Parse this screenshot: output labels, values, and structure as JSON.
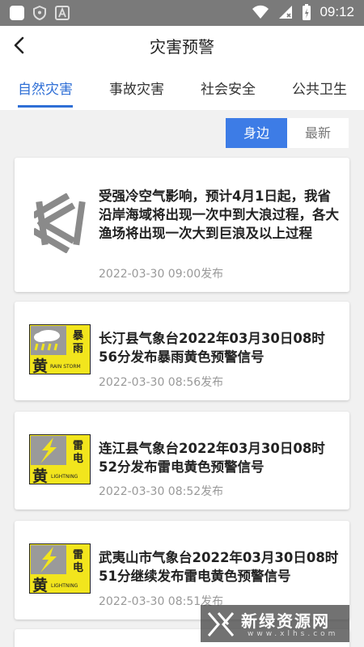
{
  "status_bar": {
    "time": "09:12"
  },
  "header": {
    "title": "灾害预警"
  },
  "tabs": [
    {
      "label": "自然灾害",
      "active": true
    },
    {
      "label": "事故灾害",
      "active": false
    },
    {
      "label": "社会安全",
      "active": false
    },
    {
      "label": "公共卫生",
      "active": false
    }
  ],
  "filter": {
    "nearby_label": "身边",
    "latest_label": "最新",
    "selected": "身边"
  },
  "warnings": [
    {
      "icon": "province-emblem-icon",
      "title": "受强冷空气影响，预计4月1日起，我省沿岸海域将出现一次中到大浪过程，各大渔场将出现一次大到巨浪及以上过程",
      "date": "2022-03-30 09:00发布"
    },
    {
      "icon": "rainstorm-yellow-warning-icon",
      "badge_top": "暴",
      "badge_mid": "雨",
      "badge_level": "黄",
      "badge_en": "RAIN STORM",
      "title": "长汀县气象台2022年03月30日08时56分发布暴雨黄色预警信号",
      "date": "2022-03-30 08:56发布"
    },
    {
      "icon": "lightning-yellow-warning-icon",
      "badge_top": "雷",
      "badge_mid": "电",
      "badge_level": "黄",
      "badge_en": "LIGHTNING",
      "title": "连江县气象台2022年03月30日08时52分发布雷电黄色预警信号",
      "date": "2022-03-30 08:52发布"
    },
    {
      "icon": "lightning-yellow-warning-icon",
      "badge_top": "雷",
      "badge_mid": "电",
      "badge_level": "黄",
      "badge_en": "LIGHTNING",
      "title": "武夷山市气象台2022年03月30日08时51分继续发布雷电黄色预警信号",
      "date": "2022-03-30 08:51发布"
    }
  ],
  "watermark": {
    "text": "新绿资源网",
    "sub": "www.xlhs.com"
  },
  "colors": {
    "accent": "#3d7ce6",
    "tab_active": "#2f6fd6",
    "badge_yellow": "#f2e51d"
  }
}
